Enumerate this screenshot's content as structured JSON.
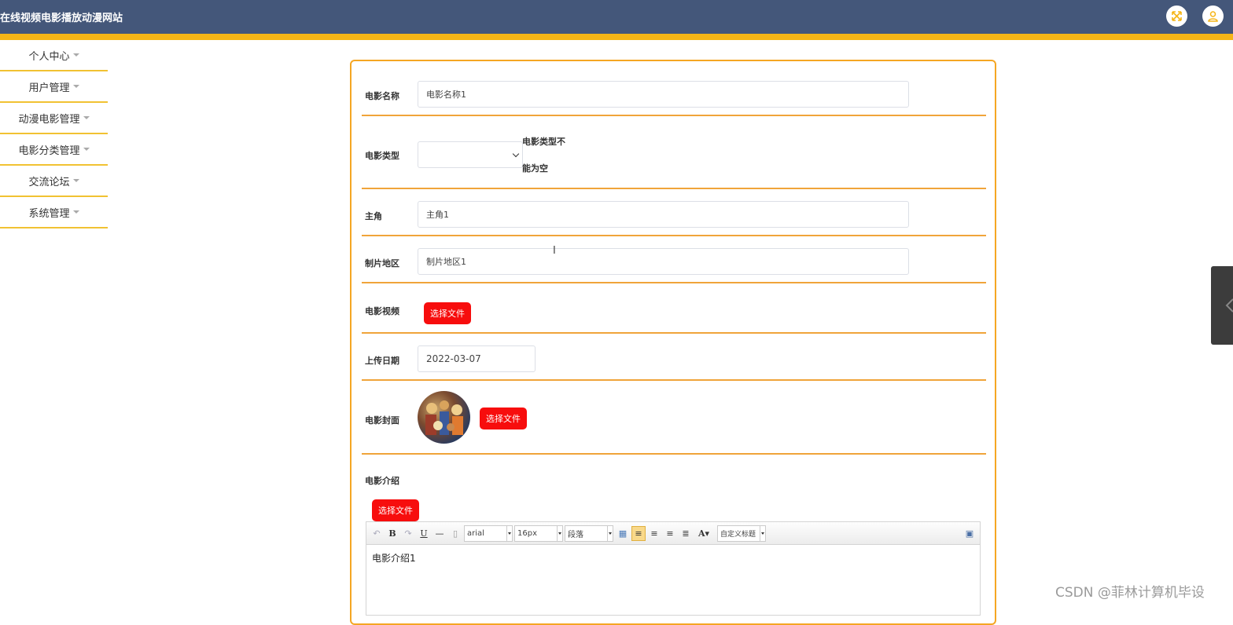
{
  "app": {
    "title": "在线视频电影播放动漫网站"
  },
  "header": {
    "icons": [
      "fullscreen-icon",
      "user-icon"
    ],
    "accent_color": "#f5b517",
    "bar_color": "#44577a"
  },
  "sidebar": {
    "items": [
      {
        "label": "个人中心"
      },
      {
        "label": "用户管理"
      },
      {
        "label": "动漫电影管理"
      },
      {
        "label": "电影分类管理"
      },
      {
        "label": "交流论坛"
      },
      {
        "label": "系统管理"
      }
    ]
  },
  "form": {
    "name": {
      "label": "电影名称",
      "value": "电影名称1"
    },
    "type": {
      "label": "电影类型",
      "value": "",
      "error": "电影类型不能为空"
    },
    "actor": {
      "label": "主角",
      "value": "主角1"
    },
    "region": {
      "label": "制片地区",
      "value": "制片地区1"
    },
    "video": {
      "label": "电影视频",
      "button": "选择文件"
    },
    "date": {
      "label": "上传日期",
      "value": "2022-03-07"
    },
    "cover": {
      "label": "电影封面",
      "button": "选择文件"
    },
    "intro": {
      "label": "电影介绍",
      "button": "选择文件",
      "content": "电影介绍1"
    }
  },
  "editor": {
    "font_family": "arial",
    "font_size": "16px",
    "paragraph": "段落",
    "custom_title": "自定义标题"
  },
  "watermark": "CSDN @菲林计算机毕设",
  "colors": {
    "button_red": "#f70d0d",
    "panel_border": "#f5a623"
  }
}
